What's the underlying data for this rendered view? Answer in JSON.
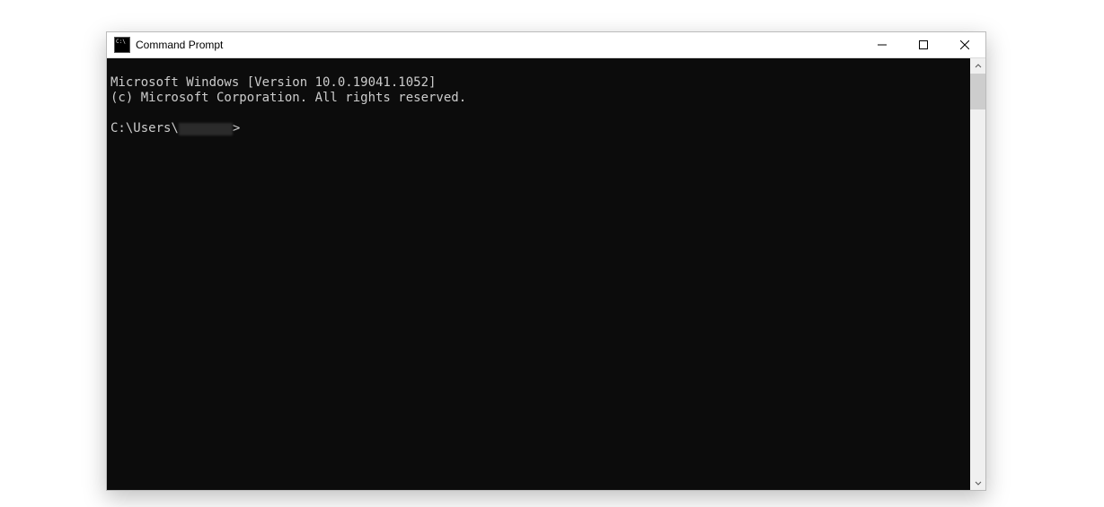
{
  "window": {
    "title": "Command Prompt"
  },
  "console": {
    "line1": "Microsoft Windows [Version 10.0.19041.1052]",
    "line2": "(c) Microsoft Corporation. All rights reserved.",
    "blank": "",
    "prompt_prefix": "C:\\Users\\",
    "prompt_suffix": ">"
  }
}
